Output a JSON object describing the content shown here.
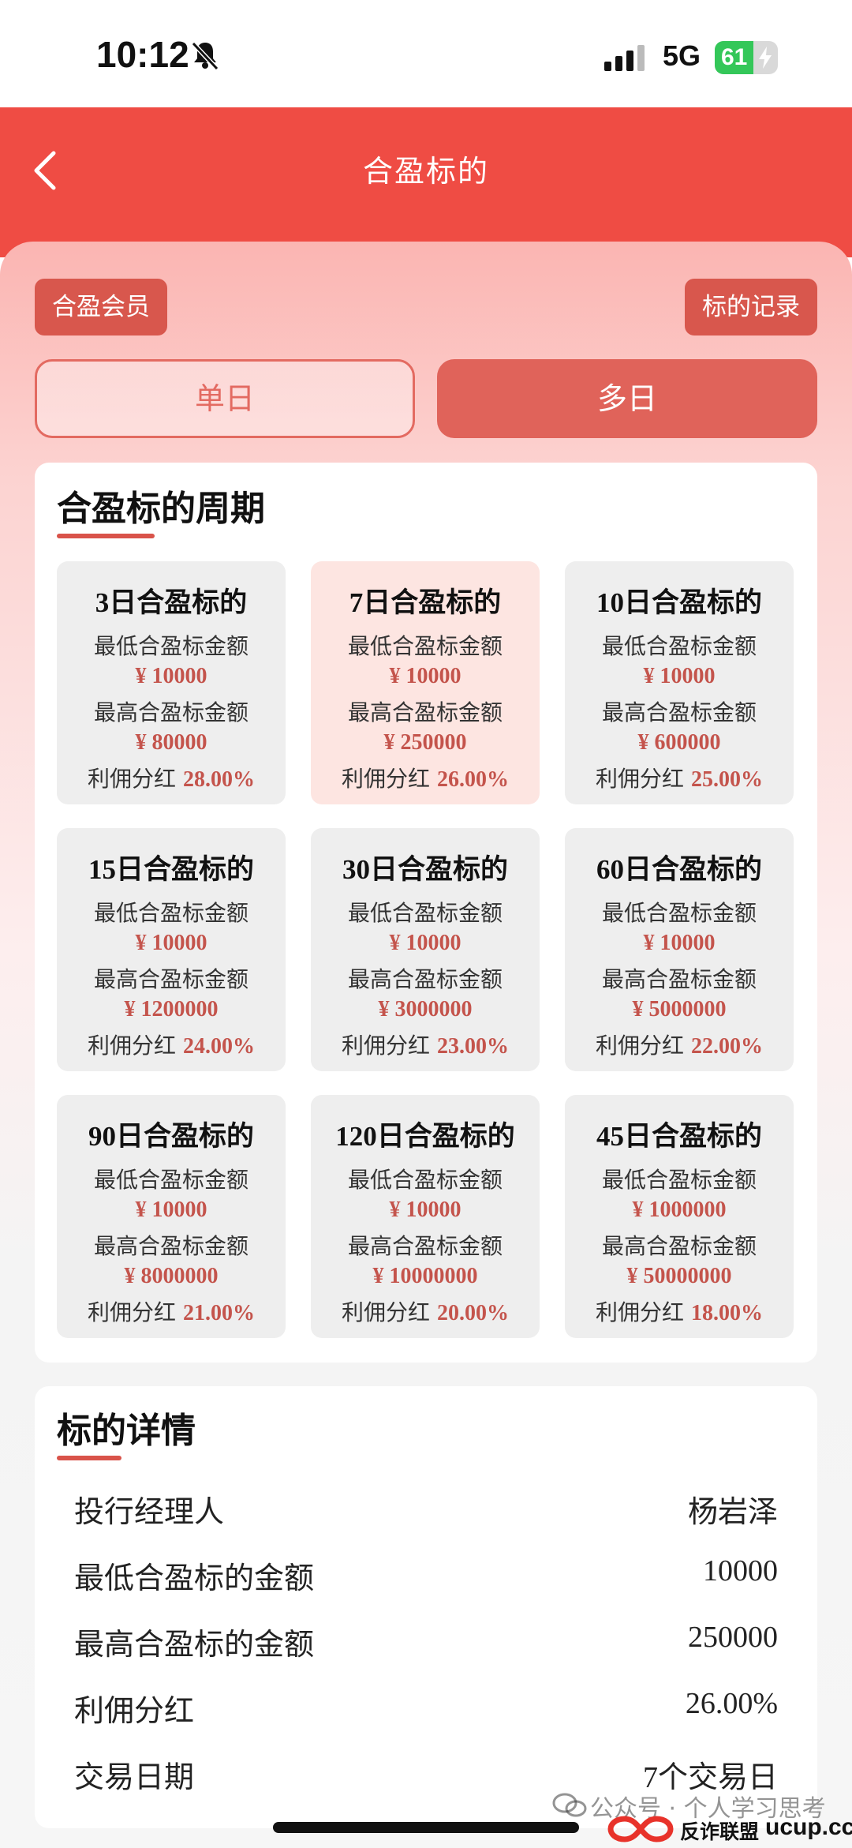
{
  "status_bar": {
    "time": "10:12",
    "network": "5G",
    "battery_percent": 61
  },
  "header": {
    "title": "合盈标的"
  },
  "top_actions": {
    "member_label": "合盈会员",
    "records_label": "标的记录"
  },
  "segments": {
    "single_label": "单日",
    "multi_label": "多日",
    "selected": "multi"
  },
  "period_section": {
    "title": "合盈标的周期",
    "min_label": "最低合盈标金额",
    "max_label": "最高合盈标金额",
    "rate_label": "利佣分红",
    "plans": [
      {
        "title": "3日合盈标的",
        "min": "¥ 10000",
        "max": "¥ 80000",
        "rate": "28.00%"
      },
      {
        "title": "7日合盈标的",
        "min": "¥ 10000",
        "max": "¥ 250000",
        "rate": "26.00%"
      },
      {
        "title": "10日合盈标的",
        "min": "¥ 10000",
        "max": "¥ 600000",
        "rate": "25.00%"
      },
      {
        "title": "15日合盈标的",
        "min": "¥ 10000",
        "max": "¥ 1200000",
        "rate": "24.00%"
      },
      {
        "title": "30日合盈标的",
        "min": "¥ 10000",
        "max": "¥ 3000000",
        "rate": "23.00%"
      },
      {
        "title": "60日合盈标的",
        "min": "¥ 10000",
        "max": "¥ 5000000",
        "rate": "22.00%"
      },
      {
        "title": "90日合盈标的",
        "min": "¥ 10000",
        "max": "¥ 8000000",
        "rate": "21.00%"
      },
      {
        "title": "120日合盈标的",
        "min": "¥ 10000",
        "max": "¥ 10000000",
        "rate": "20.00%"
      },
      {
        "title": "45日合盈标的",
        "min": "¥ 1000000",
        "max": "¥ 50000000",
        "rate": "18.00%"
      }
    ]
  },
  "details": {
    "title": "标的详情",
    "rows": [
      {
        "label": "投行经理人",
        "value": "杨岩泽"
      },
      {
        "label": "最低合盈标的金额",
        "value": "10000"
      },
      {
        "label": "最高合盈标的金额",
        "value": "250000"
      },
      {
        "label": "利佣分红",
        "value": "26.00%"
      },
      {
        "label": "交易日期",
        "value": "7个交易日"
      }
    ]
  },
  "overlay": {
    "watermark": "公众号 · 个人学习思考",
    "brand_name": "反诈联盟",
    "brand_site": "ucup.cc"
  },
  "colors": {
    "header": "#ef4c44",
    "accent": "#c4544c",
    "button": "#d8574d"
  }
}
